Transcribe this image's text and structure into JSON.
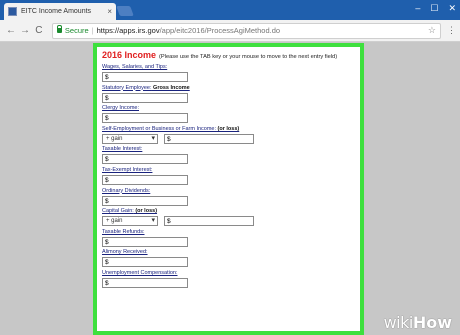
{
  "browser": {
    "tab_title": "EITC Income Amounts",
    "tab_close": "×",
    "window_buttons": [
      "–",
      "☐",
      "✕"
    ],
    "back": "←",
    "forward": "→",
    "reload": "C",
    "secure_label": "Secure",
    "separator": "|",
    "url_host": "https://apps.irs.gov",
    "url_path": "/app/eitc2016/ProcessAgiMethod.do",
    "star": "☆",
    "menu": "⋮"
  },
  "form": {
    "title": "2016 Income",
    "instructions": "(Please use the TAB key or your mouse to move to the next entry field)",
    "fields": [
      {
        "label": "Wages, Salaries, and Tips:",
        "extra": "",
        "value": "$",
        "has_select": false
      },
      {
        "label": "Statutory Employee:",
        "extra": " Gross Income",
        "value": "$",
        "has_select": false
      },
      {
        "label": "Clergy Income:",
        "extra": "",
        "value": "$",
        "has_select": false
      },
      {
        "label": "Self-Employment or Business or Farm Income:",
        "extra": " (or loss)",
        "value": "$",
        "has_select": true,
        "select_value": "+ gain"
      },
      {
        "label": "Taxable Interest:",
        "extra": "",
        "value": "$",
        "has_select": false
      },
      {
        "label": "Tax-Exempt Interest:",
        "extra": "",
        "value": "$",
        "has_select": false
      },
      {
        "label": "Ordinary Dividends:",
        "extra": "",
        "value": "$",
        "has_select": false
      },
      {
        "label": "Capital Gain:",
        "extra": " (or loss)",
        "value": "$",
        "has_select": true,
        "select_value": "+ gain"
      },
      {
        "label": "Taxable Refunds:",
        "extra": "",
        "value": "$",
        "has_select": false
      },
      {
        "label": "Alimony Received:",
        "extra": "",
        "value": "$",
        "has_select": false
      },
      {
        "label": "Unemployment Compensation:",
        "extra": "",
        "value": "$",
        "has_select": false
      }
    ]
  },
  "watermark": {
    "part1": "wiki",
    "part2": "How"
  },
  "colors": {
    "highlight_border": "#3ee03e",
    "title_red": "#e02020",
    "tab_strip": "#1f5fad"
  }
}
